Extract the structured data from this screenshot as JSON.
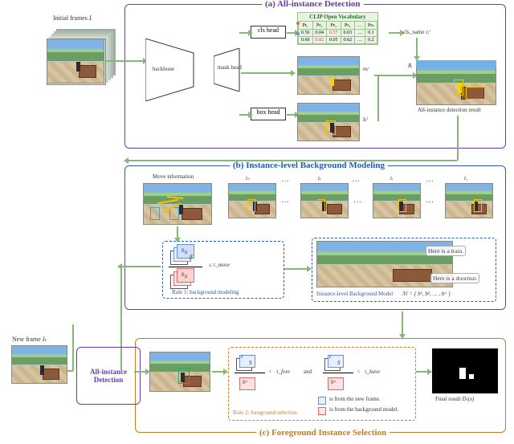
{
  "panels": {
    "a_title": "(a) All-instance Detection",
    "b_title": "(b) Instance-level Background Modeling",
    "c_title": "(c) Foreground Instance Selection"
  },
  "left": {
    "initial_frames": "Initial frames",
    "initial_frames_sym": "Iᵢ",
    "new_frame": "New frame",
    "new_frame_sym": "Iₜ",
    "aid_block": "All-instance Detection"
  },
  "a": {
    "backbone": "backbone",
    "cls_head": "cls head",
    "mask_head": "mask head",
    "box_head": "box head",
    "clip_title": "CLIP Open Vocabulary",
    "clip_cols": [
      "Pr₁",
      "Pr₂",
      "Pr₃",
      "Pr₄",
      "…",
      "Prₙ"
    ],
    "clip_row_a": [
      "0.56",
      "0.04",
      "0.57",
      "0.03",
      "…",
      "0.1"
    ],
    "clip_row_b": [
      "0.60",
      "0.82",
      "0.05",
      "0.62",
      "…",
      "0.2"
    ],
    "cls_name": "cls_name",
    "cls_sym": "cᵢˡ",
    "mask_sym": "mᵢˡ",
    "box_sym": "bᵢˡ",
    "result_sym": "Rᵢ",
    "result_caption": "All-instance detection result"
  },
  "b": {
    "move_info": "Move information",
    "frames": [
      "tₙ",
      "…",
      "tⱼ",
      "…",
      "tᵢ",
      "…",
      "t₁"
    ],
    "rule1_caption": "Rule 1: background modeling",
    "tau_move": "≤  τ_move",
    "model_header": "Instance-level Background Model",
    "cap_train": "Here is a train.",
    "cap_doormat": "Here is a doormat.",
    "model_set": "ℳ = { b¹, b², … , bᵃ }"
  },
  "c": {
    "rule2_caption": "Rule 2: foreground selection",
    "lt": "<",
    "and": "and",
    "tau_fore": "τ_fore",
    "tau_have": "τ_have",
    "c_sym": "c",
    "S_sym": "S",
    "b_sym": "bᵃ",
    "legend_new": "is from the new frame.",
    "legend_bg": "is from the background model.",
    "final_caption": "Final result",
    "final_sym": "Dₜ(x)",
    "box_c": "☐",
    "box_b": "☐"
  },
  "colors": {
    "panel_a": "#6a3ab2",
    "panel_b": "#2b5bad",
    "panel_c": "#cf7a1f",
    "arrow": "#87b87a",
    "clip_border": "#9ec28c"
  }
}
